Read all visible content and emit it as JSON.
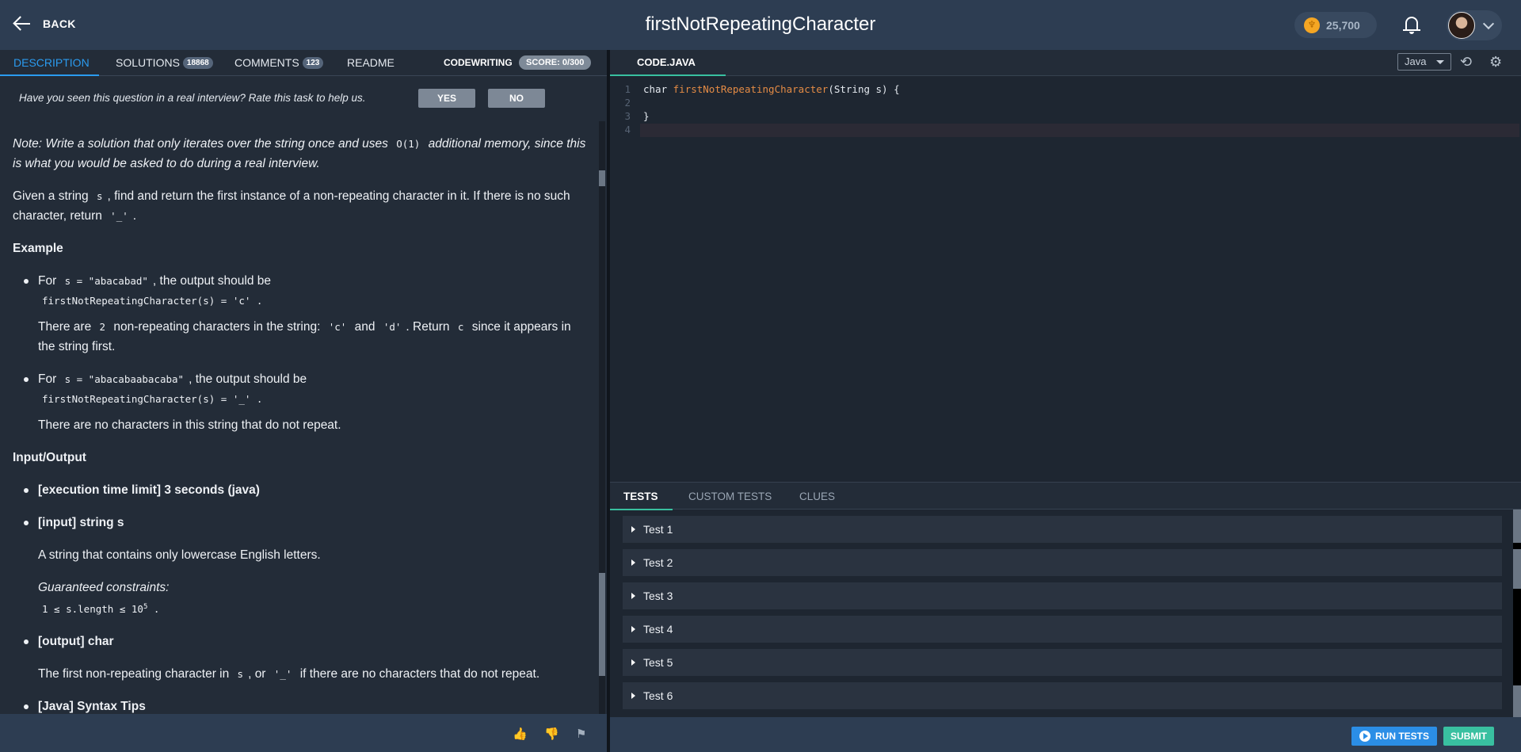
{
  "header": {
    "back_label": "BACK",
    "title": "firstNotRepeatingCharacter",
    "coins": "25,700"
  },
  "left": {
    "tabs": [
      {
        "label": "DESCRIPTION"
      },
      {
        "label": "SOLUTIONS",
        "count": "18868"
      },
      {
        "label": "COMMENTS",
        "count": "123"
      },
      {
        "label": "README"
      }
    ],
    "mode_label": "CODEWRITING",
    "score": "SCORE: 0/300",
    "rate_question": "Have you seen this question in a real interview? Rate this task to help us.",
    "yes_label": "YES",
    "no_label": "NO"
  },
  "description": {
    "note_a": "Note: Write a solution that only iterates over the string once and uses",
    "note_code": "O(1)",
    "note_b": "additional memory, since this is what you would be asked to do during a real interview.",
    "given_a": "Given a string",
    "given_code": "s",
    "given_b": ", find and return the first instance of a non-repeating character in it. If there is no such character, return",
    "given_code2": "'_'",
    "given_c": ".",
    "example_heading": "Example",
    "ex1_for": "For",
    "ex1_code": "s = \"abacabad\"",
    "ex1_after": ", the output should be",
    "ex1_output": "firstNotRepeatingCharacter(s) = 'c'",
    "ex1_exp_a": "There are",
    "ex1_exp_num": "2",
    "ex1_exp_b": "non-repeating characters in the string:",
    "ex1_exp_c1": "'c'",
    "ex1_exp_and": "and",
    "ex1_exp_c2": "'d'",
    "ex1_exp_ret": ". Return",
    "ex1_exp_c3": "c",
    "ex1_exp_end": "since it appears in the string first.",
    "ex2_for": "For",
    "ex2_code": "s = \"abacabaabacaba\"",
    "ex2_after": ", the output should be",
    "ex2_output": "firstNotRepeatingCharacter(s) = '_'",
    "ex2_exp": "There are no characters in this string that do not repeat.",
    "io_heading": "Input/Output",
    "io_time": "[execution time limit] 3 seconds (java)",
    "io_input": "[input] string s",
    "io_input_desc": "A string that contains only lowercase English letters.",
    "io_constraints": "Guaranteed constraints:",
    "io_constraint_code": "1 ≤ s.length ≤ 10",
    "io_constraint_sup": "5",
    "io_output": "[output] char",
    "io_output_a": "The first non-repeating character in",
    "io_output_code1": "s",
    "io_output_or": ", or",
    "io_output_code2": "'_'",
    "io_output_b": "if there are no characters that do not repeat.",
    "io_next_partial": "[Java] Syntax Tips"
  },
  "editor": {
    "tab_label": "CODE.JAVA",
    "language": "Java",
    "lines": [
      {
        "num": "1",
        "pre": "char ",
        "fn": "firstNotRepeatingCharacter",
        "post": "(String s) {"
      },
      {
        "num": "2",
        "pre": "",
        "fn": "",
        "post": ""
      },
      {
        "num": "3",
        "pre": "}",
        "fn": "",
        "post": ""
      },
      {
        "num": "4",
        "pre": "",
        "fn": "",
        "post": ""
      }
    ]
  },
  "tests_panel": {
    "tabs": [
      "TESTS",
      "CUSTOM TESTS",
      "CLUES"
    ],
    "tests": [
      "Test 1",
      "Test 2",
      "Test 3",
      "Test 4",
      "Test 5",
      "Test 6"
    ],
    "run_label": "RUN TESTS",
    "submit_label": "SUBMIT"
  },
  "icons": {
    "back": "arrow-left-icon",
    "coin": "coin-icon",
    "bell": "bell-icon",
    "reset": "reset-icon",
    "settings": "gear-icon",
    "like": "thumbs-up-icon",
    "dislike": "thumbs-down-icon",
    "flag": "flag-icon"
  },
  "colors": {
    "accent_blue": "#2b9bef",
    "accent_green": "#39c0a0",
    "function_orange": "#e48b45"
  }
}
